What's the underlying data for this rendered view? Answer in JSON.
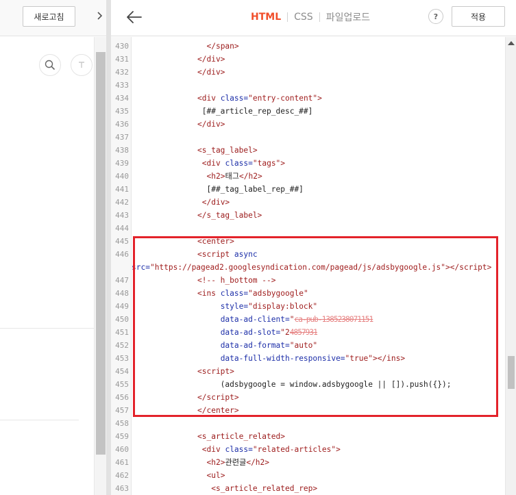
{
  "left_panel": {
    "refresh_label": "새로고침",
    "collapse_icon": "chevron-right-icon"
  },
  "topbar": {
    "back_icon": "arrow-left-icon",
    "tabs": [
      {
        "label": "HTML",
        "active": true
      },
      {
        "label": "CSS",
        "active": false
      },
      {
        "label": "파일업로드",
        "active": false
      }
    ],
    "help_label": "?",
    "apply_label": "적용"
  },
  "colors": {
    "accent": "#f14e2a",
    "highlight": "#e3222a"
  },
  "code": {
    "lines": [
      {
        "n": "430",
        "html": "  <span class='t'>&lt;/span&gt;</span>"
      },
      {
        "n": "431",
        "html": "<span class='t'>&lt;/div&gt;</span>"
      },
      {
        "n": "432",
        "html": "<span class='t'>&lt;/div&gt;</span>"
      },
      {
        "n": "433",
        "html": ""
      },
      {
        "n": "434",
        "html": "<span class='t'>&lt;div</span> <span class='a'>class=</span><span class='s'>\"entry-content\"</span><span class='t'>&gt;</span>"
      },
      {
        "n": "435",
        "html": " [##_article_rep_desc_##]"
      },
      {
        "n": "436",
        "html": "<span class='t'>&lt;/div&gt;</span>"
      },
      {
        "n": "437",
        "html": ""
      },
      {
        "n": "438",
        "html": "<span class='t'>&lt;s_tag_label&gt;</span>"
      },
      {
        "n": "439",
        "html": " <span class='t'>&lt;div</span> <span class='a'>class=</span><span class='s'>\"tags\"</span><span class='t'>&gt;</span>"
      },
      {
        "n": "440",
        "html": "  <span class='t'>&lt;h2&gt;</span>태그<span class='t'>&lt;/h2&gt;</span>"
      },
      {
        "n": "441",
        "html": "  [##_tag_label_rep_##]"
      },
      {
        "n": "442",
        "html": " <span class='t'>&lt;/div&gt;</span>"
      },
      {
        "n": "443",
        "html": "<span class='t'>&lt;/s_tag_label&gt;</span>"
      },
      {
        "n": "444",
        "html": ""
      },
      {
        "n": "445",
        "html": "<span class='t'>&lt;center&gt;</span>"
      },
      {
        "n": "446",
        "html": "<span class='t'>&lt;script</span> <span class='a'>async</span>"
      },
      {
        "n": "",
        "wrap": true,
        "html": "<span class='a'>src=</span><span class='s'>\"https://pagead2.googlesyndication.com/pagead/js/adsbygoogle.js\"</span><span class='t'>&gt;&lt;/script&gt;</span>"
      },
      {
        "n": "447",
        "html": "<span class='c'>&lt;!-- h_bottom --&gt;</span>"
      },
      {
        "n": "448",
        "html": "<span class='t'>&lt;ins</span> <span class='a'>class=</span><span class='s'>\"adsbygoogle\"</span>"
      },
      {
        "n": "449",
        "html": "     <span class='a'>style=</span><span class='s'>\"display:block\"</span>"
      },
      {
        "n": "450",
        "html": "     <span class='a'>data-ad-client=</span><span class='s'>\"</span><span class='blur'>ca-pub-1385238071151</span>"
      },
      {
        "n": "451",
        "html": "     <span class='a'>data-ad-slot=</span><span class='s'>\"2</span><span class='blur'>4857931</span>"
      },
      {
        "n": "452",
        "html": "     <span class='a'>data-ad-format=</span><span class='s'>\"auto\"</span>"
      },
      {
        "n": "453",
        "html": "     <span class='a'>data-full-width-responsive=</span><span class='s'>\"true\"</span><span class='t'>&gt;&lt;/ins&gt;</span>"
      },
      {
        "n": "454",
        "html": "<span class='t'>&lt;script&gt;</span>"
      },
      {
        "n": "455",
        "html": "     (adsbygoogle = window.adsbygoogle || []).push({});"
      },
      {
        "n": "456",
        "html": "<span class='t'>&lt;/script&gt;</span>"
      },
      {
        "n": "457",
        "html": "<span class='t'>&lt;/center&gt;</span>"
      },
      {
        "n": "458",
        "html": ""
      },
      {
        "n": "459",
        "html": "<span class='t'>&lt;s_article_related&gt;</span>"
      },
      {
        "n": "460",
        "html": " <span class='t'>&lt;div</span> <span class='a'>class=</span><span class='s'>\"related-articles\"</span><span class='t'>&gt;</span>"
      },
      {
        "n": "461",
        "html": "  <span class='t'>&lt;h2&gt;</span>관련글<span class='t'>&lt;/h2&gt;</span>"
      },
      {
        "n": "462",
        "html": "  <span class='t'>&lt;ul&gt;</span>"
      },
      {
        "n": "463",
        "html": "   <span class='t'>&lt;s_article_related_rep&gt;</span>"
      }
    ]
  }
}
